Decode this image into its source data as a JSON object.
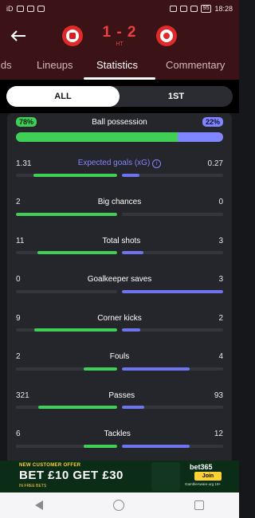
{
  "status_bar": {
    "left": "iD",
    "time": "18:28",
    "battery": "95"
  },
  "match": {
    "score": "1 - 2",
    "period": "HT"
  },
  "tabs": [
    "ids",
    "Lineups",
    "Statistics",
    "Commentary"
  ],
  "period_filter": [
    "ALL",
    "1ST"
  ],
  "possession": {
    "label": "Ball possession",
    "home": "78%",
    "away": "22%",
    "home_value": 78,
    "away_value": 22
  },
  "stats": [
    {
      "label": "Expected goals (xG)",
      "home": "1.31",
      "away": "0.27",
      "home_fill": 0.83,
      "away_fill": 0.17
    },
    {
      "label": "Big chances",
      "home": "2",
      "away": "0",
      "home_fill": 1.0,
      "away_fill": 0.0
    },
    {
      "label": "Total shots",
      "home": "11",
      "away": "3",
      "home_fill": 0.79,
      "away_fill": 0.21
    },
    {
      "label": "Goalkeeper saves",
      "home": "0",
      "away": "3",
      "home_fill": 0.0,
      "away_fill": 1.0
    },
    {
      "label": "Corner kicks",
      "home": "9",
      "away": "2",
      "home_fill": 0.82,
      "away_fill": 0.18
    },
    {
      "label": "Fouls",
      "home": "2",
      "away": "4",
      "home_fill": 0.33,
      "away_fill": 0.67
    },
    {
      "label": "Passes",
      "home": "321",
      "away": "93",
      "home_fill": 0.78,
      "away_fill": 0.22
    },
    {
      "label": "Tackles",
      "home": "6",
      "away": "12",
      "home_fill": 0.33,
      "away_fill": 0.67
    }
  ],
  "ad": {
    "tag": "NEW CUSTOMER OFFER",
    "main": "BET £10 GET £30",
    "sub": "IN FREE BETS",
    "brand": "bet365",
    "cta": "Join",
    "small": "GambleAware.org 18+"
  },
  "colors": {
    "header": "#3b1316",
    "home": "#3fcf57",
    "away": "#8086ff",
    "score": "#e94040"
  }
}
